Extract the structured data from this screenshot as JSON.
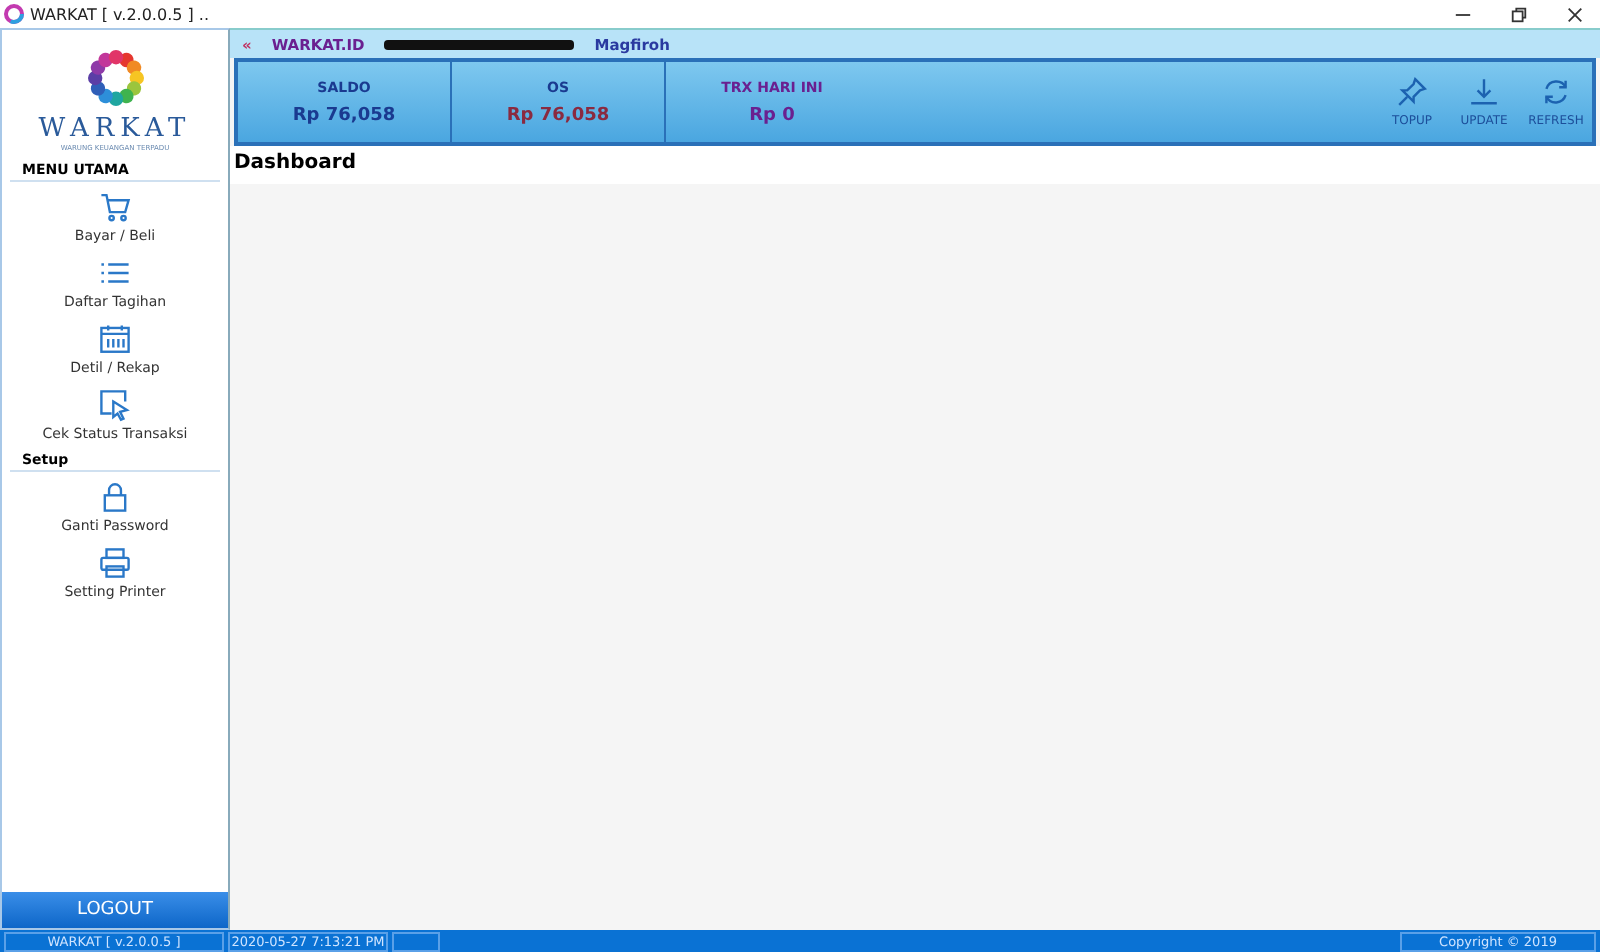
{
  "window": {
    "title": "WARKAT [ v.2.0.0.5 ] .."
  },
  "logo": {
    "name": "WARKAT",
    "tagline": "WARUNG KEUANGAN TERPADU"
  },
  "sidebar": {
    "sections": [
      {
        "title": "MENU UTAMA",
        "items": [
          {
            "label": "Bayar / Beli",
            "kind": "cart"
          },
          {
            "label": "Daftar Tagihan",
            "kind": "list"
          },
          {
            "label": "Detil / Rekap",
            "kind": "calendar"
          },
          {
            "label": "Cek Status Transaksi",
            "kind": "cursor"
          }
        ]
      },
      {
        "title": "Setup",
        "items": [
          {
            "label": "Ganti Password",
            "kind": "lock"
          },
          {
            "label": "Setting Printer",
            "kind": "printer"
          }
        ]
      }
    ],
    "logout": "LOGOUT"
  },
  "header": {
    "back": "«",
    "brand": "WARKAT.ID",
    "user_name": "Magfiroh"
  },
  "stats": [
    {
      "label": "SALDO",
      "value": "Rp 76,058"
    },
    {
      "label": "OS",
      "value": "Rp 76,058"
    },
    {
      "label": "TRX HARI INI",
      "value": "Rp 0"
    }
  ],
  "actions": [
    {
      "label": "TOPUP",
      "kind": "pin"
    },
    {
      "label": "UPDATE",
      "kind": "download"
    },
    {
      "label": "REFRESH",
      "kind": "refresh"
    }
  ],
  "page_title": "Dashboard",
  "status_bar": {
    "version": "WARKAT [ v.2.0.0.5 ]",
    "datetime": "2020-05-27 7:13:21 PM",
    "copyright": "Copyright © 2019"
  }
}
